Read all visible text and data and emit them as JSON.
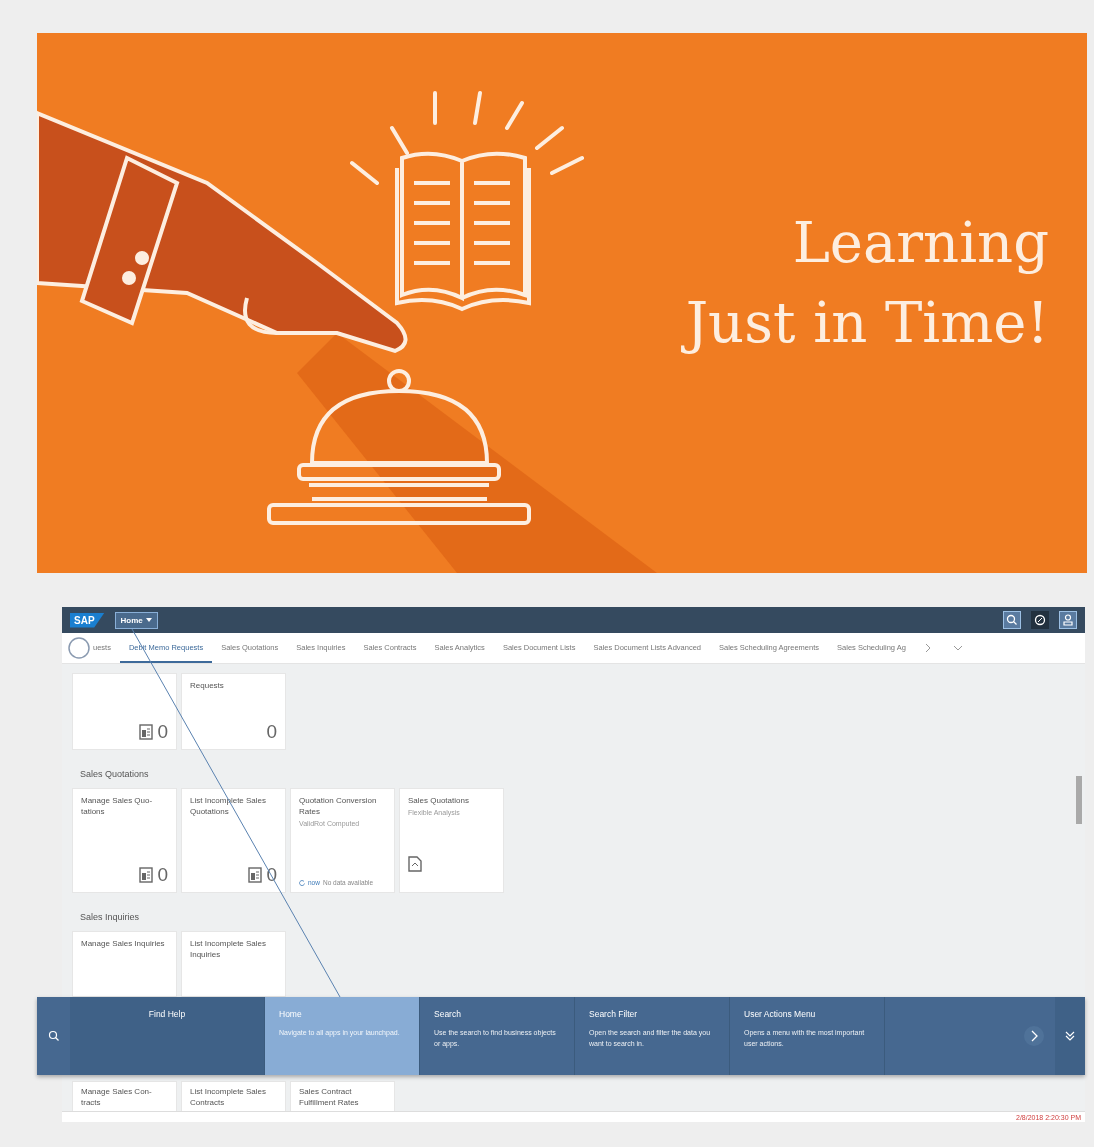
{
  "banner": {
    "title_lines": [
      "Learning",
      "Just in Time!"
    ]
  },
  "screen": {
    "shell": {
      "logo": "SAP",
      "home_button": "Home"
    },
    "tabs": [
      {
        "label": "uests",
        "selected": false
      },
      {
        "label": "Debit Memo Requests",
        "selected": true
      },
      {
        "label": "Sales Quotations",
        "selected": false
      },
      {
        "label": "Sales Inquiries",
        "selected": false
      },
      {
        "label": "Sales Contracts",
        "selected": false
      },
      {
        "label": "Sales Analytics",
        "selected": false
      },
      {
        "label": "Sales Document Lists",
        "selected": false
      },
      {
        "label": "Sales Document Lists Advanced",
        "selected": false
      },
      {
        "label": "Sales Scheduling Agreements",
        "selected": false
      },
      {
        "label": "Sales Scheduling Ag",
        "selected": false
      }
    ],
    "groups": [
      {
        "tiles": [
          {
            "kind": "count",
            "count": "0"
          },
          {
            "kind": "number",
            "title": "Requests",
            "count": "0"
          }
        ]
      },
      {
        "heading": "Sales Quotations",
        "tiles": [
          {
            "kind": "count",
            "title": "Manage Sales Quo-tations",
            "count": "0"
          },
          {
            "kind": "count",
            "title": "List Incomplete Sales Quotations",
            "count": "0"
          },
          {
            "kind": "kpi",
            "title": "Quotation Conversion Rates",
            "subtitle": "ValidRot Computed",
            "refresh": "now",
            "status": "No data available"
          },
          {
            "kind": "analysis",
            "title": "Sales Quotations",
            "subtitle": "Flexible Analysis"
          }
        ]
      },
      {
        "heading": "Sales Inquiries",
        "tiles": [
          {
            "kind": "plain",
            "title": "Manage Sales Inquiries"
          },
          {
            "kind": "plain",
            "title": "List Incomplete Sales Inquiries"
          }
        ]
      },
      {
        "tiles": [
          {
            "kind": "plain",
            "title": "Manage Sales Con-tracts"
          },
          {
            "kind": "plain",
            "title": "List Incomplete Sales Contracts"
          },
          {
            "kind": "plain",
            "title": "Sales Contract Fulfillment Rates"
          }
        ]
      }
    ],
    "help_bar": {
      "items": [
        {
          "kind": "label",
          "title": "Find Help",
          "selected": false
        },
        {
          "kind": "tip",
          "title": "Home",
          "description": "Navigate to all apps in your launchpad.",
          "selected": true
        },
        {
          "kind": "tip",
          "title": "Search",
          "description": "Use the search to find business objects or apps.",
          "selected": false
        },
        {
          "kind": "tip",
          "title": "Search Filter",
          "description": "Open the search and filter the data you want to search in.",
          "selected": false
        },
        {
          "kind": "tip",
          "title": "User Actions Menu",
          "description": "Opens a menu with the most important user actions.",
          "selected": false
        }
      ]
    },
    "timestamp": "2/8/2018 2:20:30 PM"
  }
}
